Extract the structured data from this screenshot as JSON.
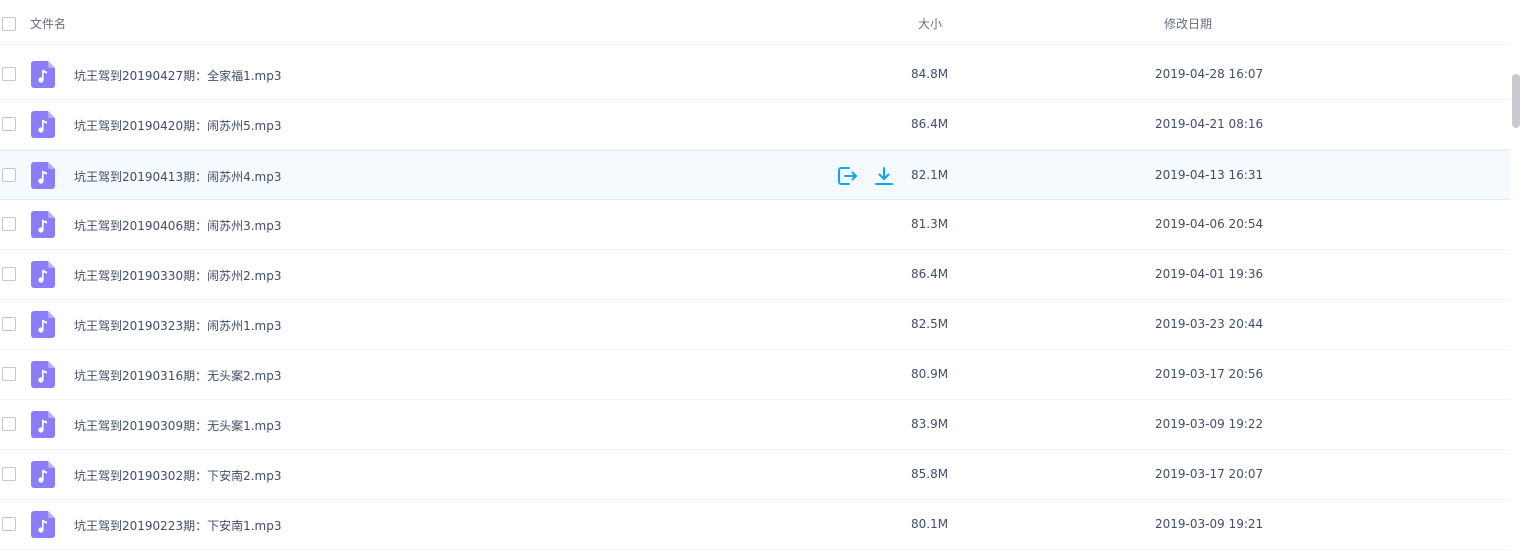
{
  "header": {
    "name_label": "文件名",
    "size_label": "大小",
    "date_label": "修改日期"
  },
  "icons": {
    "file": "music-file-icon",
    "share": "share-icon",
    "download": "download-icon"
  },
  "colors": {
    "file_icon": "#8b7cf7",
    "action_icon": "#06a7ff",
    "hover_row": "#f5faff"
  },
  "files": [
    {
      "name": "坑王驾到20190427期：全家福1.mp3",
      "size": "84.8M",
      "date": "2019-04-28 16:07"
    },
    {
      "name": "坑王驾到20190420期：闹苏州5.mp3",
      "size": "86.4M",
      "date": "2019-04-21 08:16"
    },
    {
      "name": "坑王驾到20190413期：闹苏州4.mp3",
      "size": "82.1M",
      "date": "2019-04-13 16:31"
    },
    {
      "name": "坑王驾到20190406期：闹苏州3.mp3",
      "size": "81.3M",
      "date": "2019-04-06 20:54"
    },
    {
      "name": "坑王驾到20190330期：闹苏州2.mp3",
      "size": "86.4M",
      "date": "2019-04-01 19:36"
    },
    {
      "name": "坑王驾到20190323期：闹苏州1.mp3",
      "size": "82.5M",
      "date": "2019-03-23 20:44"
    },
    {
      "name": "坑王驾到20190316期：无头案2.mp3",
      "size": "80.9M",
      "date": "2019-03-17 20:56"
    },
    {
      "name": "坑王驾到20190309期：无头案1.mp3",
      "size": "83.9M",
      "date": "2019-03-09 19:22"
    },
    {
      "name": "坑王驾到20190302期：下安南2.mp3",
      "size": "85.8M",
      "date": "2019-03-17 20:07"
    },
    {
      "name": "坑王驾到20190223期：下安南1.mp3",
      "size": "80.1M",
      "date": "2019-03-09 19:21"
    }
  ]
}
